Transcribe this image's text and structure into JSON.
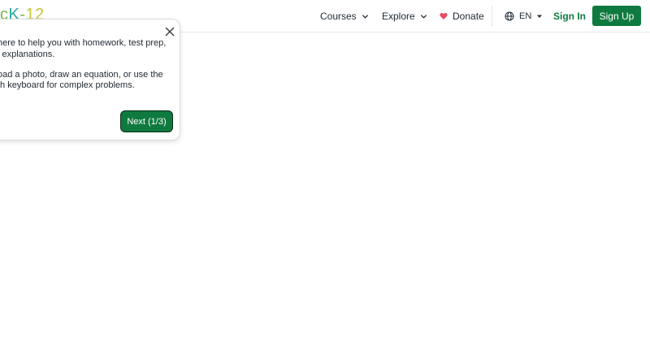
{
  "logo": {
    "part1": "c",
    "part2": "K",
    "part3": "-",
    "part4": "12"
  },
  "nav": {
    "courses": "Courses",
    "explore": "Explore",
    "donate": "Donate",
    "language": "EN",
    "sign_in": "Sign In",
    "sign_up": "Sign Up"
  },
  "popover": {
    "line1": "here to help you with homework, test prep,",
    "line2": "l explanations.",
    "line3": "oad a photo, draw an equation, or use the",
    "line4": "th keyboard for complex problems.",
    "next_label": "Next (1/3)"
  },
  "colors": {
    "brand_green": "#0f7a3f",
    "donate_heart": "#e84a5f"
  }
}
